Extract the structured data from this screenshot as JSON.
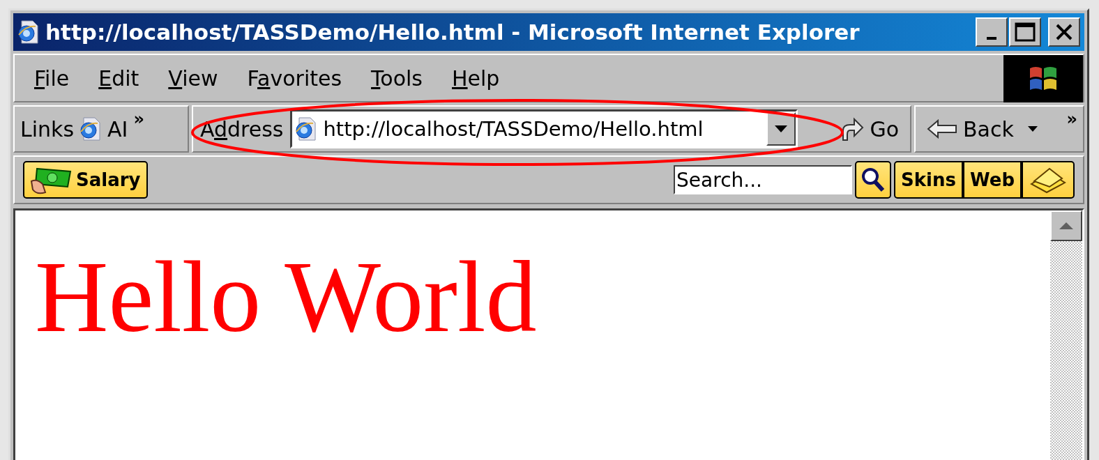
{
  "window": {
    "title": "http://localhost/TASSDemo/Hello.html - Microsoft Internet Explorer"
  },
  "menu": [
    {
      "label": [
        {
          "text": "F",
          "underlined": true
        },
        {
          "text": "ile",
          "underlined": false
        }
      ]
    },
    {
      "label": [
        {
          "text": "E",
          "underlined": true
        },
        {
          "text": "dit",
          "underlined": false
        }
      ]
    },
    {
      "label": [
        {
          "text": "V",
          "underlined": true
        },
        {
          "text": "iew",
          "underlined": false
        }
      ]
    },
    {
      "label": [
        {
          "text": "F",
          "underlined": false
        },
        {
          "text": "a",
          "underlined": true
        },
        {
          "text": "vorites",
          "underlined": false
        }
      ]
    },
    {
      "label": [
        {
          "text": "T",
          "underlined": true
        },
        {
          "text": "ools",
          "underlined": false
        }
      ]
    },
    {
      "label": [
        {
          "text": "H",
          "underlined": true
        },
        {
          "text": "elp",
          "underlined": false
        }
      ]
    }
  ],
  "links_bar": {
    "label": "Links",
    "link": "AI",
    "more": "»"
  },
  "address_bar": {
    "label": [
      {
        "text": "A",
        "underlined": false
      },
      {
        "text": "d",
        "underlined": true
      },
      {
        "text": "dress",
        "underlined": false
      }
    ],
    "value": "http://localhost/TASSDemo/Hello.html",
    "go": "Go"
  },
  "nav": {
    "back": "Back",
    "more": "»"
  },
  "custom_toolbar": {
    "salary": "Salary",
    "search_value": "Search...",
    "skins": "Skins",
    "web": "Web"
  },
  "page": {
    "heading": "Hello World"
  }
}
